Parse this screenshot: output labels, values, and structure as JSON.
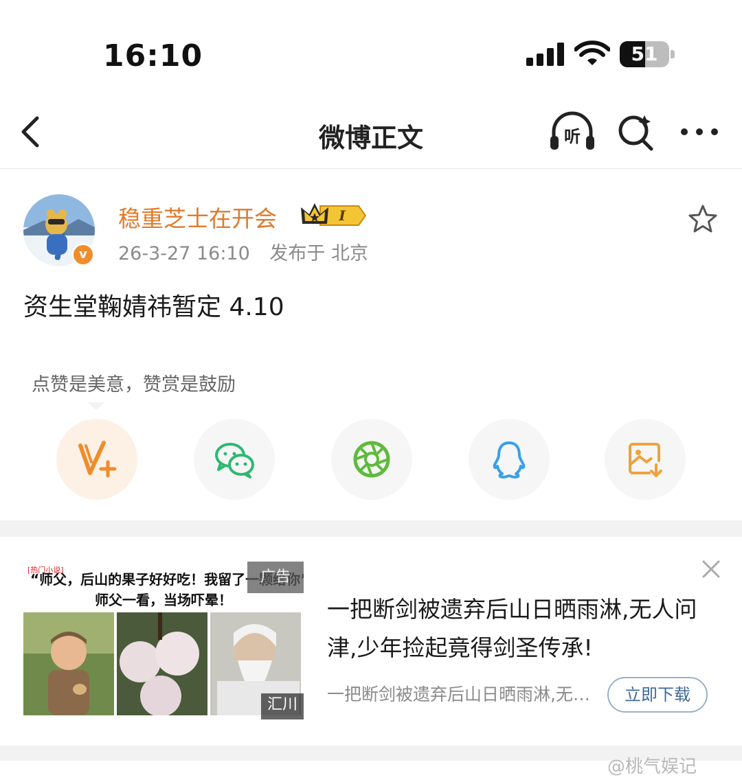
{
  "status_bar": {
    "time": "16:10",
    "battery": "51",
    "battery_level": 0.51
  },
  "nav": {
    "title": "微博正文",
    "listen_label": "听"
  },
  "post": {
    "author": "稳重芝士在开会",
    "vip_level": "I",
    "date": "26-3-27 16:10",
    "location": "发布于 北京",
    "verified_symbol": "v",
    "text": "资生堂鞠婧祎暂定 4.10"
  },
  "reward_hint": "点赞是美意，赞赏是鼓励",
  "share_buttons": [
    {
      "name": "reward",
      "icon": "weibo-reward-icon"
    },
    {
      "name": "wechat",
      "icon": "wechat-icon"
    },
    {
      "name": "moments",
      "icon": "moments-icon"
    },
    {
      "name": "qq",
      "icon": "qq-icon"
    },
    {
      "name": "save-image",
      "icon": "save-image-icon"
    }
  ],
  "ad": {
    "image_tag": "[热门小说]",
    "image_line1": "“师父，后山的果子好好吃！我留了一颗给你”",
    "image_line2": "师父一看，当场吓晕！",
    "label": "广告",
    "brand": "汇川",
    "title": "一把断剑被遗弃后山日晒雨淋,无人问津,少年捡起竟得剑圣传承!",
    "subtitle": "一把断剑被遗弃后山日晒雨淋,无人问津,少年捡起竟得剑圣传承!",
    "download_label": "立即下载"
  },
  "watermark": "@桃气娱记",
  "colors": {
    "accent_orange": "#e07a2a",
    "link_blue": "#3f6a98",
    "verified_orange": "#f08c2c"
  }
}
